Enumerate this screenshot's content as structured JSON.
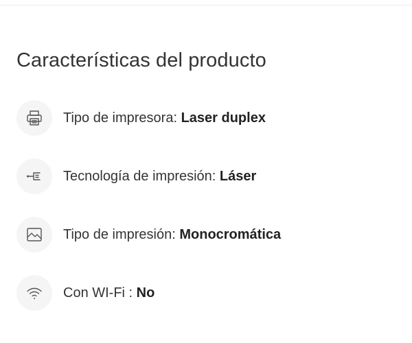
{
  "section": {
    "title": "Características del producto"
  },
  "features": [
    {
      "icon": "printer-icon",
      "label": "Tipo de impresora: ",
      "value": "Laser duplex"
    },
    {
      "icon": "usb-connector-icon",
      "label": "Tecnología de impresión: ",
      "value": "Láser"
    },
    {
      "icon": "image-icon",
      "label": "Tipo de impresión: ",
      "value": "Monocromática"
    },
    {
      "icon": "wifi-icon",
      "label": "Con WI-Fi : ",
      "value": "No"
    }
  ]
}
